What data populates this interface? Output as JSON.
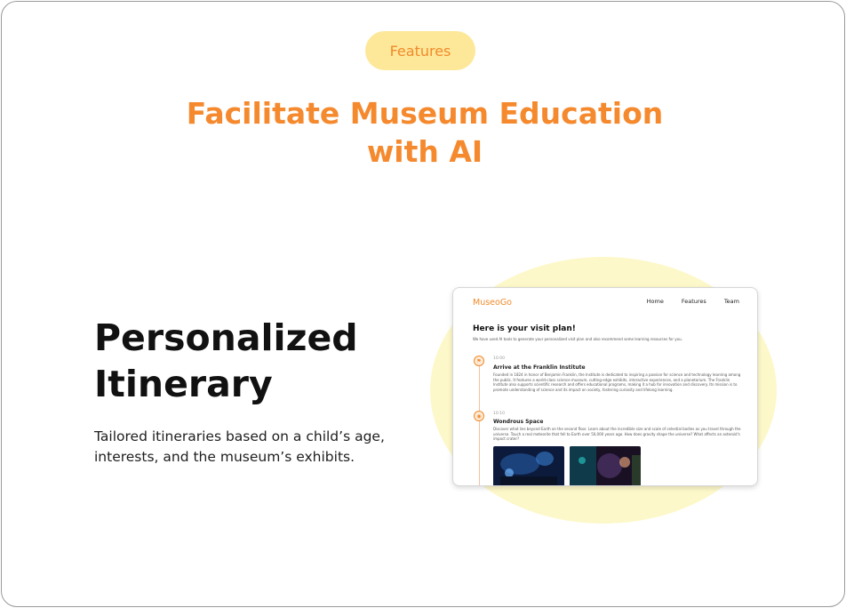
{
  "section": {
    "badge": "Features",
    "heading_line1": "Facilitate Museum Education",
    "heading_line2": "with AI"
  },
  "feature": {
    "title_line1": "Personalized",
    "title_line2": "Itinerary",
    "desc_line1": "Tailored itineraries based on a child’s age,",
    "desc_line2": "interests, and the museum’s exhibits."
  },
  "mockup": {
    "logo": "MuseoGo",
    "nav": [
      "Home",
      "Features",
      "Team"
    ],
    "title": "Here is your visit plan!",
    "subtitle": "We have used AI tools to generate your personalized visit plan and also recommend some learning resources for you.",
    "stops": [
      {
        "time": "10:00",
        "name": "Arrive at the Franklin Institute",
        "icon": "flag-icon",
        "text": "Founded in 1824 in honor of Benjamin Franklin, the Institute is dedicated to inspiring a passion for science and technology learning among the public. It features a world-class science museum, cutting-edge exhibits, interactive experiences, and a planetarium. The Franklin Institute also supports scientific research and offers educational programs, making it a hub for innovation and discovery. Its mission is to promote understanding of science and its impact on society, fostering curiosity and lifelong learning."
      },
      {
        "time": "10:10",
        "name": "Wondrous Space",
        "icon": "pin-icon",
        "text": "Discover what lies beyond Earth on the second floor. Learn about the incredible size and scale of celestial bodies as you travel through the universe. Touch a real meteorite that fell to Earth over 50,000 years ago. How does gravity shape the universe? What affects an asteroid's impact crater?"
      }
    ]
  },
  "colors": {
    "accent": "#f5892e",
    "badge_bg": "#fde89a",
    "blob": "#fdf8c9"
  }
}
